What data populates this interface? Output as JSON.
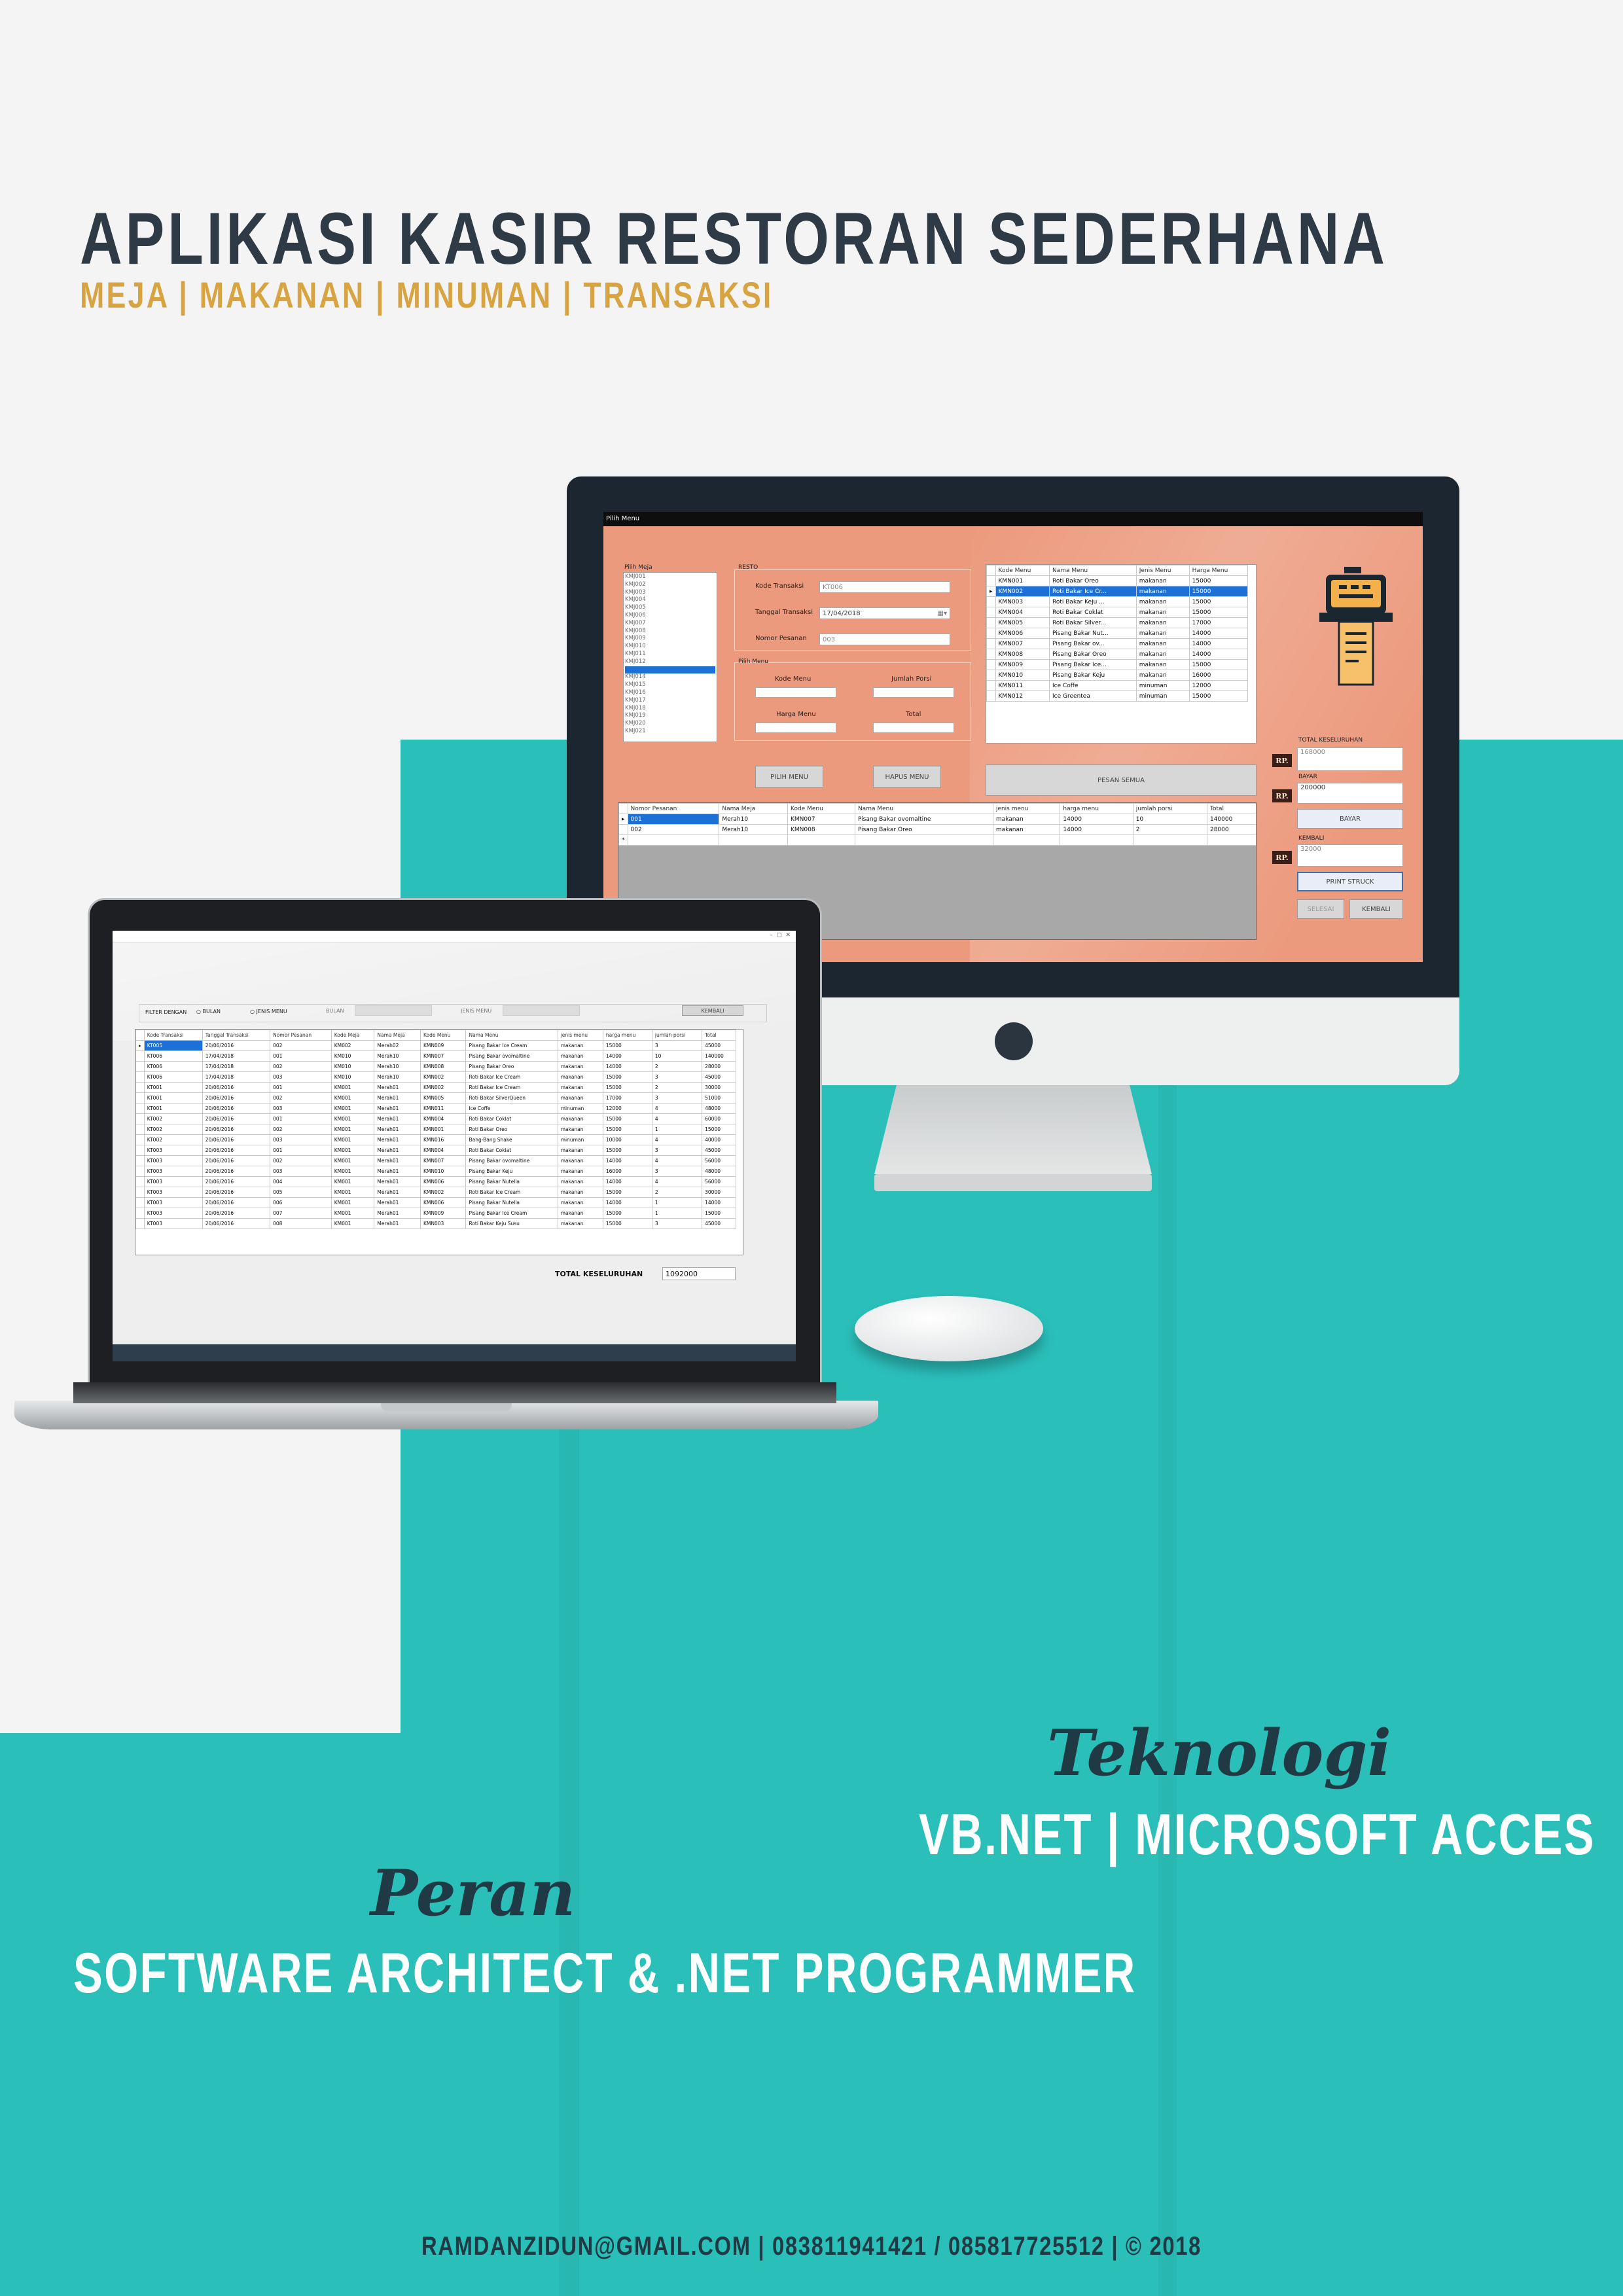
{
  "poster": {
    "title": "APLIKASI KASIR RESTORAN SEDERHANA",
    "subtitle": "MEJA | MAKANAN | MINUMAN | TRANSAKSI",
    "tech_heading": "Teknologi",
    "tech_text": "VB.NET | MICROSOFT ACCES",
    "role_heading": "Peran",
    "role_text": "SOFTWARE ARCHITECT & .NET PROGRAMMER",
    "footer": "RAMDANZIDUN@GMAIL.COM | 083811941421 / 085817725512 | © 2018"
  },
  "colors": {
    "teal": "#2bbfba",
    "title": "#2e3a45",
    "accent": "#d8a441",
    "form_bg": "#ec9a7d"
  },
  "monitor_app": {
    "window_title": "Pilih Menu",
    "pilih_meja_label": "Pilih Meja",
    "meja_list": [
      "KMJ001",
      "KMJ002",
      "KMJ003",
      "KMJ004",
      "KMJ005",
      "KMJ006",
      "KMJ007",
      "KMJ008",
      "KMJ009",
      "KMJ010",
      "KMJ011",
      "KMJ012",
      "KMJ013",
      "KMJ014",
      "KMJ015",
      "KMJ016",
      "KMJ017",
      "KMJ018",
      "KMJ019",
      "KMJ020",
      "KMJ021"
    ],
    "resto_group": "RESTO",
    "kode_transaksi_label": "Kode Transaksi",
    "kode_transaksi_value": "KT006",
    "tanggal_label": "Tanggal Transaksi",
    "tanggal_value": "17/04/2018",
    "nomor_pesanan_label": "Nomor Pesanan",
    "nomor_pesanan_value": "003",
    "pilih_menu_group": "Pilih Menu",
    "kode_menu_label": "Kode Menu",
    "jumlah_porsi_label": "Jumlah Porsi",
    "harga_menu_label": "Harga Menu",
    "total_label": "Total",
    "pilih_menu_btn": "PILIH MENU",
    "hapus_menu_btn": "HAPUS MENU",
    "pesan_semua_btn": "PESAN SEMUA",
    "menu_grid": {
      "headers": [
        "Kode Menu",
        "Nama Menu",
        "Jenis Menu",
        "Harga Menu"
      ],
      "rows": [
        [
          "KMN001",
          "Roti Bakar Oreo",
          "makanan",
          "15000"
        ],
        [
          "KMN002",
          "Roti Bakar Ice Cr...",
          "makanan",
          "15000"
        ],
        [
          "KMN003",
          "Roti Bakar Keju ...",
          "makanan",
          "15000"
        ],
        [
          "KMN004",
          "Roti Bakar Coklat",
          "makanan",
          "15000"
        ],
        [
          "KMN005",
          "Roti Bakar Silver...",
          "makanan",
          "17000"
        ],
        [
          "KMN006",
          "Pisang Bakar Nut...",
          "makanan",
          "14000"
        ],
        [
          "KMN007",
          "Pisang Bakar ov...",
          "makanan",
          "14000"
        ],
        [
          "KMN008",
          "Pisang Bakar Oreo",
          "makanan",
          "14000"
        ],
        [
          "KMN009",
          "Pisang Bakar Ice...",
          "makanan",
          "15000"
        ],
        [
          "KMN010",
          "Pisang Bakar Keju",
          "makanan",
          "16000"
        ],
        [
          "KMN011",
          "Ice Coffe",
          "minuman",
          "12000"
        ],
        [
          "KMN012",
          "Ice Greentea",
          "minuman",
          "15000"
        ]
      ]
    },
    "total_keseluruhan_label": "TOTAL KESELURUHAN",
    "total_keseluruhan_value": "168000",
    "bayar_label": "BAYAR",
    "bayar_value": "200000",
    "bayar_btn": "BAYAR",
    "kembali_label": "KEMBALI",
    "kembali_value": "32000",
    "print_btn": "PRINT STRUCK",
    "selesai_btn": "SELESAI",
    "kembali_btn": "KEMBALI",
    "rp": "RP.",
    "order_grid": {
      "headers": [
        "Nomor Pesanan",
        "Nama Meja",
        "Kode Menu",
        "Nama Menu",
        "jenis menu",
        "harga menu",
        "jumlah porsi",
        "Total"
      ],
      "rows": [
        [
          "001",
          "Merah10",
          "KMN007",
          "Pisang Bakar ovomaltine",
          "makanan",
          "14000",
          "10",
          "140000"
        ],
        [
          "002",
          "Merah10",
          "KMN008",
          "Pisang Bakar Oreo",
          "makanan",
          "14000",
          "2",
          "28000"
        ]
      ]
    }
  },
  "laptop_app": {
    "filter_label": "FILTER DENGAN",
    "radio_bulan": "BULAN",
    "radio_jenis": "JENIS MENU",
    "bulan_label": "BULAN",
    "jenis_menu_label": "JENIS MENU",
    "kembali_btn": "KEMBALI",
    "grid": {
      "headers": [
        "Kode Transaksi",
        "Tanggal Transaksi",
        "Nomor Pesanan",
        "Kode Meja",
        "Nama Meja",
        "Kode Menu",
        "Nama Menu",
        "jenis menu",
        "harga menu",
        "jumlah porsi",
        "Total"
      ],
      "rows": [
        [
          "KT005",
          "20/06/2016",
          "002",
          "KM002",
          "Merah02",
          "KMN009",
          "Pisang Bakar Ice Cream",
          "makanan",
          "15000",
          "3",
          "45000"
        ],
        [
          "KT006",
          "17/04/2018",
          "001",
          "KM010",
          "Merah10",
          "KMN007",
          "Pisang Bakar ovomaltine",
          "makanan",
          "14000",
          "10",
          "140000"
        ],
        [
          "KT006",
          "17/04/2018",
          "002",
          "KM010",
          "Merah10",
          "KMN008",
          "Pisang Bakar Oreo",
          "makanan",
          "14000",
          "2",
          "28000"
        ],
        [
          "KT006",
          "17/04/2018",
          "003",
          "KM010",
          "Merah10",
          "KMN002",
          "Roti Bakar Ice Cream",
          "makanan",
          "15000",
          "3",
          "45000"
        ],
        [
          "KT001",
          "20/06/2016",
          "001",
          "KM001",
          "Merah01",
          "KMN002",
          "Roti Bakar Ice Cream",
          "makanan",
          "15000",
          "2",
          "30000"
        ],
        [
          "KT001",
          "20/06/2016",
          "002",
          "KM001",
          "Merah01",
          "KMN005",
          "Roti Bakar SilverQueen",
          "makanan",
          "17000",
          "3",
          "51000"
        ],
        [
          "KT001",
          "20/06/2016",
          "003",
          "KM001",
          "Merah01",
          "KMN011",
          "Ice Coffe",
          "minuman",
          "12000",
          "4",
          "48000"
        ],
        [
          "KT002",
          "20/06/2016",
          "001",
          "KM001",
          "Merah01",
          "KMN004",
          "Roti Bakar Coklat",
          "makanan",
          "15000",
          "4",
          "60000"
        ],
        [
          "KT002",
          "20/06/2016",
          "002",
          "KM001",
          "Merah01",
          "KMN001",
          "Roti Bakar Oreo",
          "makanan",
          "15000",
          "1",
          "15000"
        ],
        [
          "KT002",
          "20/06/2016",
          "003",
          "KM001",
          "Merah01",
          "KMN016",
          "Bang-Bang Shake",
          "minuman",
          "10000",
          "4",
          "40000"
        ],
        [
          "KT003",
          "20/06/2016",
          "001",
          "KM001",
          "Merah01",
          "KMN004",
          "Roti Bakar Coklat",
          "makanan",
          "15000",
          "3",
          "45000"
        ],
        [
          "KT003",
          "20/06/2016",
          "002",
          "KM001",
          "Merah01",
          "KMN007",
          "Pisang Bakar ovomaltine",
          "makanan",
          "14000",
          "4",
          "56000"
        ],
        [
          "KT003",
          "20/06/2016",
          "003",
          "KM001",
          "Merah01",
          "KMN010",
          "Pisang Bakar Keju",
          "makanan",
          "16000",
          "3",
          "48000"
        ],
        [
          "KT003",
          "20/06/2016",
          "004",
          "KM001",
          "Merah01",
          "KMN006",
          "Pisang Bakar Nutella",
          "makanan",
          "14000",
          "4",
          "56000"
        ],
        [
          "KT003",
          "20/06/2016",
          "005",
          "KM001",
          "Merah01",
          "KMN002",
          "Roti Bakar Ice Cream",
          "makanan",
          "15000",
          "2",
          "30000"
        ],
        [
          "KT003",
          "20/06/2016",
          "006",
          "KM001",
          "Merah01",
          "KMN006",
          "Pisang Bakar Nutella",
          "makanan",
          "14000",
          "1",
          "14000"
        ],
        [
          "KT003",
          "20/06/2016",
          "007",
          "KM001",
          "Merah01",
          "KMN009",
          "Pisang Bakar Ice Cream",
          "makanan",
          "15000",
          "1",
          "15000"
        ],
        [
          "KT003",
          "20/06/2016",
          "008",
          "KM001",
          "Merah01",
          "KMN003",
          "Roti Bakar Keju Susu",
          "makanan",
          "15000",
          "3",
          "45000"
        ]
      ]
    },
    "total_label": "TOTAL KESELURUHAN",
    "total_value": "1092000"
  }
}
